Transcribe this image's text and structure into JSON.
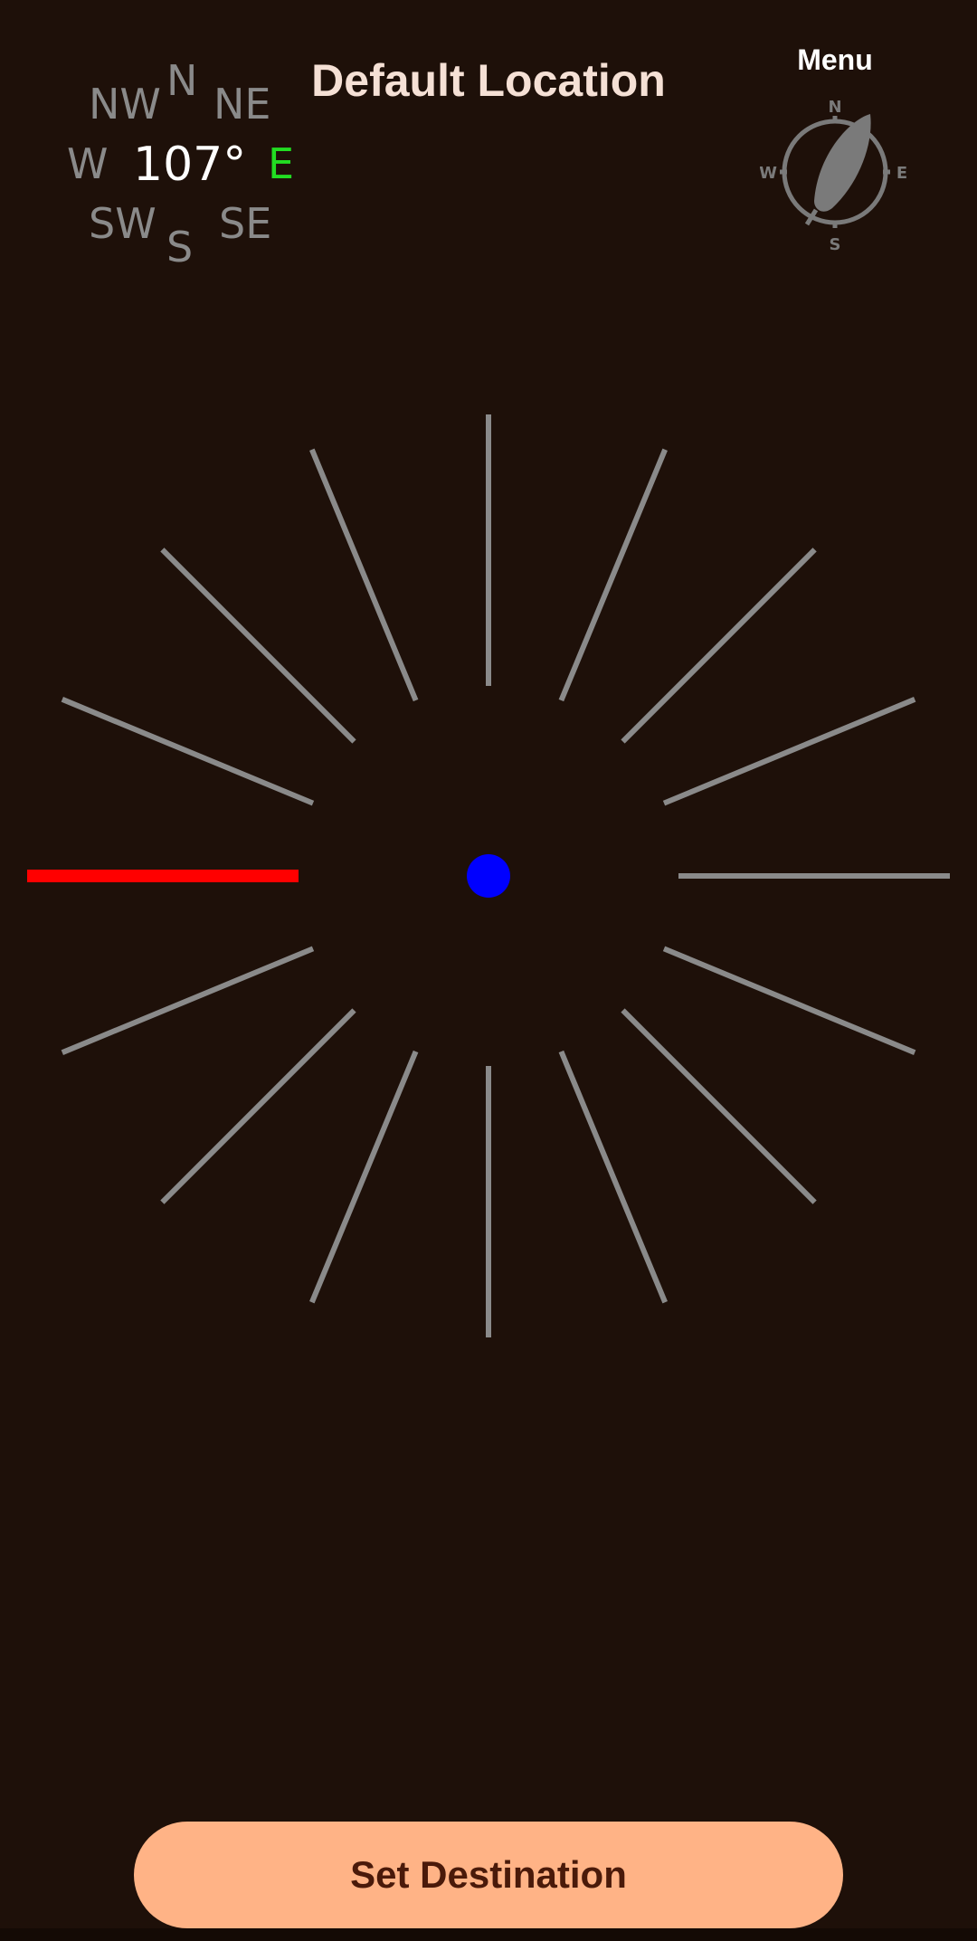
{
  "direction_rose": {
    "n": "N",
    "ne": "NE",
    "e": "E",
    "se": "SE",
    "s": "S",
    "sw": "SW",
    "w": "W",
    "nw": "NW",
    "heading": "107°",
    "active_direction": "E",
    "active_color": "#22dd22",
    "inactive_color": "#8a8a8a"
  },
  "header": {
    "title": "Default Location"
  },
  "menu": {
    "label": "Menu",
    "icon": "compass-feather-icon",
    "icon_letters": {
      "n": "N",
      "e": "E",
      "s": "S",
      "w": "W"
    }
  },
  "compass": {
    "ray_count": 16,
    "ray_color": "#8a8a8a",
    "highlight_ray_color": "#ff0000",
    "highlight_ray_direction": "W",
    "center_dot_color": "#0000ff"
  },
  "actions": {
    "set_destination_label": "Set Destination"
  },
  "colors": {
    "background": "#1e1009",
    "title": "#f5e0d5",
    "button_bg": "#ffb386",
    "button_text": "#4a1a0a"
  }
}
